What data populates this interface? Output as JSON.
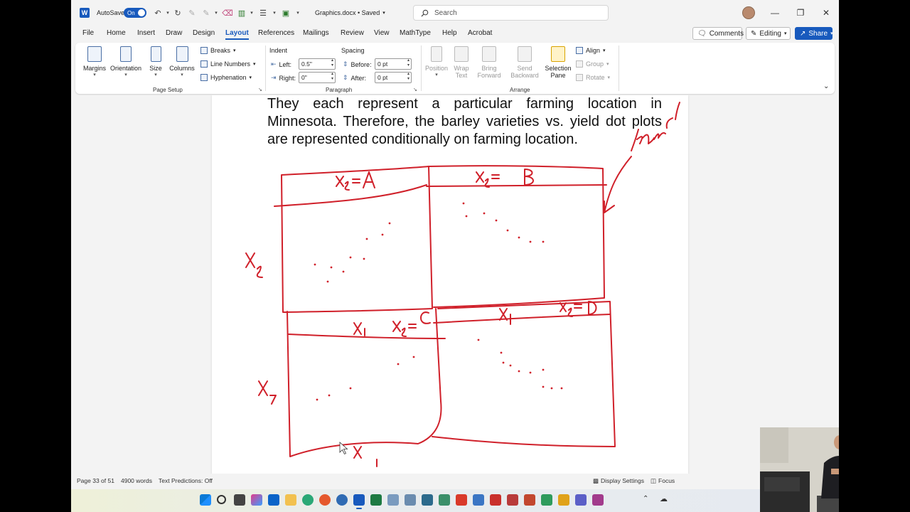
{
  "titlebar": {
    "autosave_label": "AutoSave",
    "autosave_state": "On",
    "doc_title": "Graphics.docx • Saved",
    "search_placeholder": "Search"
  },
  "tabs": [
    "File",
    "Home",
    "Insert",
    "Draw",
    "Design",
    "Layout",
    "References",
    "Mailings",
    "Review",
    "View",
    "MathType",
    "Help",
    "Acrobat"
  ],
  "active_tab": "Layout",
  "tab_buttons": {
    "comments": "Comments",
    "editing": "Editing",
    "share": "Share"
  },
  "ribbon": {
    "page_setup": {
      "margins": "Margins",
      "orientation": "Orientation",
      "size": "Size",
      "columns": "Columns",
      "breaks": "Breaks",
      "line_numbers": "Line Numbers",
      "hyphenation": "Hyphenation",
      "group_label": "Page Setup"
    },
    "paragraph": {
      "indent_label": "Indent",
      "spacing_label": "Spacing",
      "left_label": "Left:",
      "left_value": "0.5\"",
      "right_label": "Right:",
      "right_value": "0\"",
      "before_label": "Before:",
      "before_value": "0 pt",
      "after_label": "After:",
      "after_value": "0 pt",
      "group_label": "Paragraph"
    },
    "arrange": {
      "position": "Position",
      "wrap_text_1": "Wrap",
      "wrap_text_2": "Text",
      "bring_forward_1": "Bring",
      "bring_forward_2": "Forward",
      "send_backward_1": "Send",
      "send_backward_2": "Backward",
      "selection_pane_1": "Selection",
      "selection_pane_2": "Pane",
      "align": "Align",
      "group": "Group",
      "rotate": "Rotate",
      "group_label": "Arrange"
    }
  },
  "document": {
    "paragraph": "They each represent a particular farming location in Minnesota. Therefore, the barley varieties vs. yield dot plots are represented conditionally on farming location."
  },
  "statusbar": {
    "page": "Page 33 of 51",
    "words": "4900 words",
    "text_predictions": "Text Predictions: Off",
    "display_settings": "Display Settings",
    "focus": "Focus"
  },
  "colors": {
    "accent": "#185abd",
    "ink": "#d0202a"
  }
}
